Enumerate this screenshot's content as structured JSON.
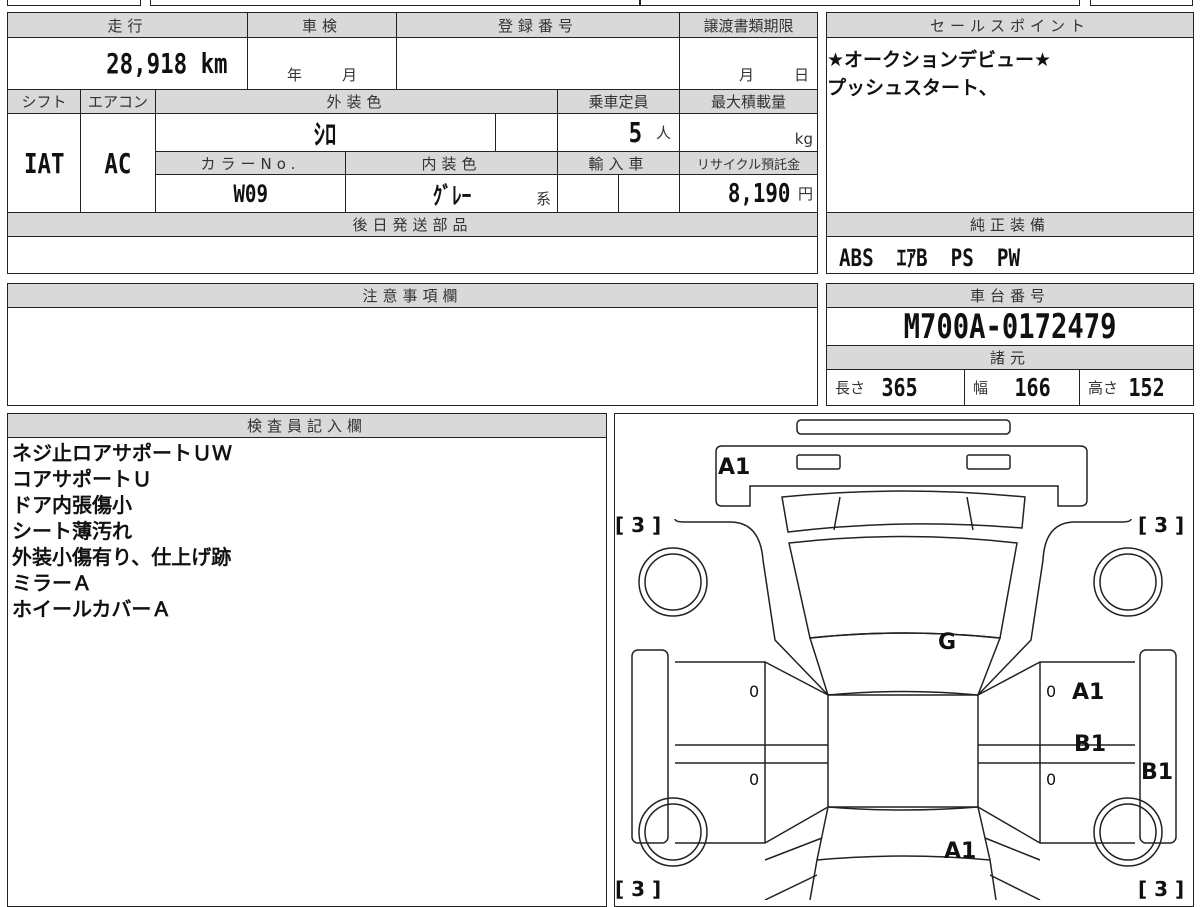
{
  "headers": {
    "mileage": "走行",
    "shaken": "車検",
    "registration": "登録番号",
    "transfer_deadline": "譲渡書類期限",
    "shift": "シフト",
    "aircon": "エアコン",
    "exterior_color": "外装色",
    "capacity": "乗車定員",
    "max_load": "最大積載量",
    "color_no": "カラーNo.",
    "interior_color": "内装色",
    "import": "輸入車",
    "recycle": "リサイクル預託金",
    "later_parts": "後日発送部品",
    "sales_point": "セールスポイント",
    "equipment": "純正装備",
    "notes": "注意事項欄",
    "chassis": "車台番号",
    "specs": "諸元",
    "inspector": "検査員記入欄"
  },
  "values": {
    "mileage": "28,918 km",
    "shaken_year": "年",
    "shaken_month": "月",
    "transfer_month": "月",
    "transfer_day": "日",
    "shift": "IAT",
    "aircon": "AC",
    "exterior_color": "ｼﾛ",
    "capacity": "5",
    "capacity_unit": "人",
    "max_load_unit": "kg",
    "color_no": "W09",
    "interior_color": "ｸﾞﾚｰ",
    "interior_suffix": "系",
    "recycle": "8,190",
    "recycle_unit": "円"
  },
  "sales_point": "★オークションデビュー★\nプッシュスタート、",
  "equipment": "ABS  ｴｱB  PS  PW",
  "chassis_no": "M700A-0172479",
  "specs": {
    "length_label": "長さ",
    "length": "365",
    "width_label": "幅",
    "width": "166",
    "height_label": "高さ",
    "height": "152"
  },
  "inspector_notes": "ネジ止ロアサポートＵＷ\nコアサポートＵ\nドア内張傷小\nシート薄汚れ\n外装小傷有り、仕上げ跡\nミラーＡ\nホイールカバーＡ",
  "diagram": {
    "front_bumper": "A1",
    "tire_fl": "[ 3 ]",
    "tire_fr": "[ 3 ]",
    "tire_rl": "[ 3 ]",
    "tire_rr": "[ 3 ]",
    "roof": "G",
    "door_lf": "0",
    "door_lr": "0",
    "door_rf": "0",
    "door_rr": "0",
    "door_rf_mark": "A1",
    "door_rr_mark": "B1",
    "sill_r": "B1",
    "rear": "A1"
  }
}
